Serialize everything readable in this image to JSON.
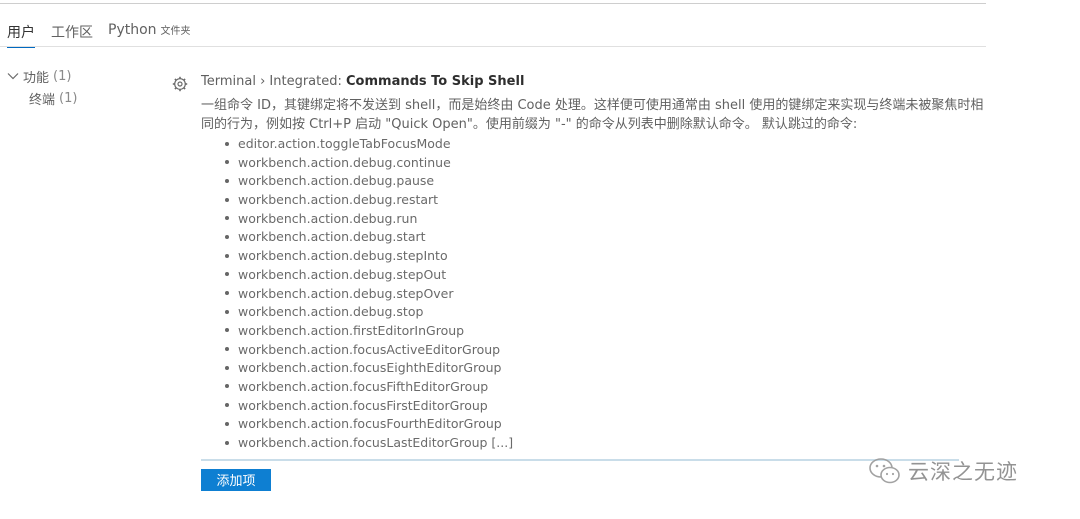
{
  "tabs": [
    {
      "label": "用户"
    },
    {
      "label": "工作区"
    },
    {
      "label": "Python",
      "sub": "文件夹"
    }
  ],
  "toc": [
    {
      "label": "功能",
      "count": "(1)"
    },
    {
      "label": "终端",
      "count": "(1)"
    }
  ],
  "setting": {
    "prefix": "Terminal › Integrated: ",
    "name": "Commands To Skip Shell",
    "description": "一组命令 ID，其键绑定将不发送到 shell，而是始终由 Code 处理。这样便可使用通常由 shell 使用的键绑定来实现与终端未被聚焦时相同的行为，例如按 Ctrl+P 启动 \"Quick Open\"。使用前缀为 \"-\" 的命令从列表中删除默认命令。 默认跳过的命令:",
    "commands": [
      "editor.action.toggleTabFocusMode",
      "workbench.action.debug.continue",
      "workbench.action.debug.pause",
      "workbench.action.debug.restart",
      "workbench.action.debug.run",
      "workbench.action.debug.start",
      "workbench.action.debug.stepInto",
      "workbench.action.debug.stepOut",
      "workbench.action.debug.stepOver",
      "workbench.action.debug.stop",
      "workbench.action.firstEditorInGroup",
      "workbench.action.focusActiveEditorGroup",
      "workbench.action.focusEighthEditorGroup",
      "workbench.action.focusFifthEditorGroup",
      "workbench.action.focusFirstEditorGroup",
      "workbench.action.focusFourthEditorGroup",
      "workbench.action.focusLastEditorGroup [...]"
    ],
    "add_button": "添加项"
  },
  "watermark": {
    "text": "云深之无迹",
    "icon": "wechat-icon"
  },
  "colors": {
    "accent": "#0e7fd2",
    "tab_underline": "#0069c0"
  }
}
